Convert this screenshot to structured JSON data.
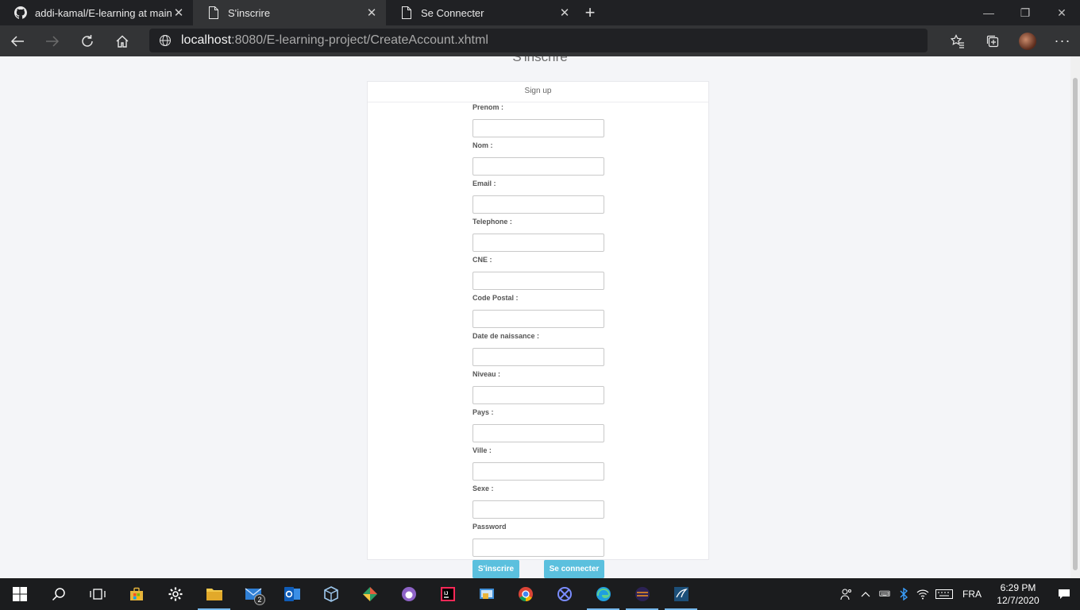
{
  "browser": {
    "tabs": [
      {
        "title": "addi-kamal/E-learning at main",
        "icon": "github-icon"
      },
      {
        "title": "S'inscrire",
        "icon": "page-icon"
      },
      {
        "title": "Se Connecter",
        "icon": "page-icon"
      }
    ],
    "url_host": "localhost",
    "url_rest": ":8080/E-learning-project/CreateAccount.xhtml"
  },
  "page": {
    "heading": "S'inscrire",
    "card_header": "Sign up",
    "fields": [
      {
        "label": "Prenom :",
        "value": ""
      },
      {
        "label": "Nom :",
        "value": ""
      },
      {
        "label": "Email :",
        "value": ""
      },
      {
        "label": "Telephone :",
        "value": ""
      },
      {
        "label": "CNE :",
        "value": ""
      },
      {
        "label": "Code Postal :",
        "value": ""
      },
      {
        "label": "Date de naissance :",
        "value": ""
      },
      {
        "label": "Niveau :",
        "value": ""
      },
      {
        "label": "Pays :",
        "value": ""
      },
      {
        "label": "Ville :",
        "value": ""
      },
      {
        "label": "Sexe :",
        "value": ""
      },
      {
        "label": "Password",
        "value": ""
      }
    ],
    "signup_button": "S'inscrire",
    "login_button": "Se connecter",
    "button_color": "#5bc0de"
  },
  "taskbar": {
    "mail_badge": "2",
    "language": "FRA",
    "time": "6:29 PM",
    "date": "12/7/2020"
  }
}
